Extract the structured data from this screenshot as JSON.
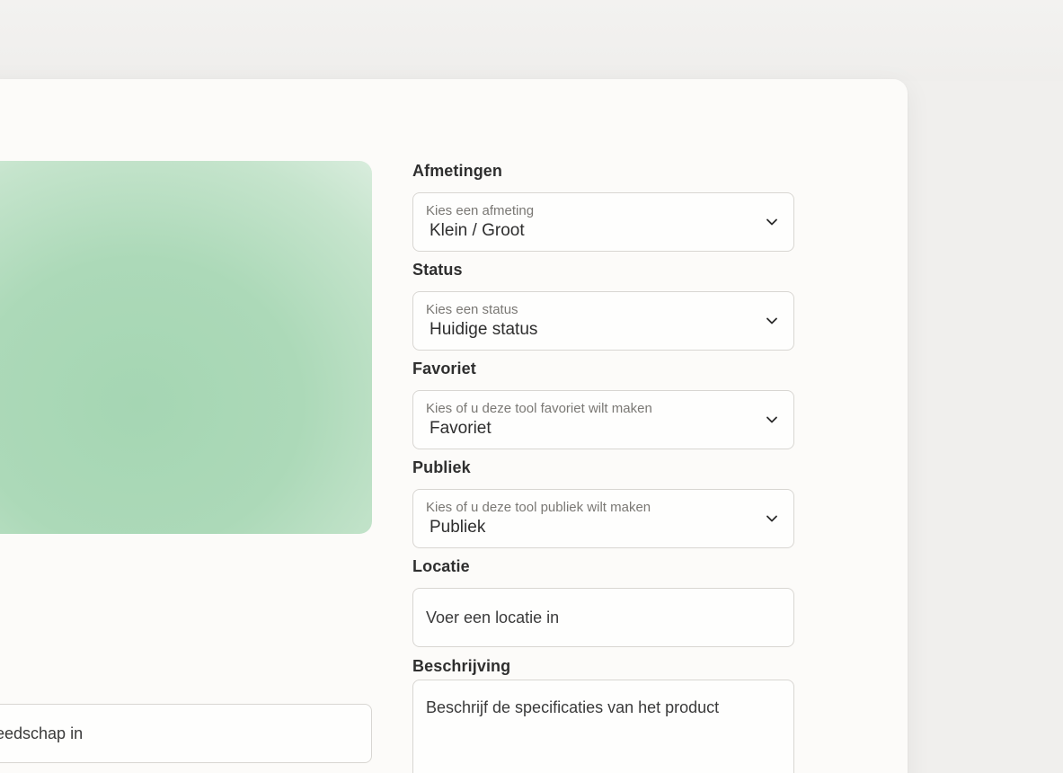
{
  "left_panel": {
    "image_alt": "",
    "name_input_partial": "ereedschap in"
  },
  "form": {
    "afmetingen": {
      "label": "Afmetingen",
      "hint": "Kies een afmeting",
      "value": "Klein / Groot"
    },
    "status": {
      "label": "Status",
      "hint": "Kies een status",
      "value": "Huidige status"
    },
    "favoriet": {
      "label": "Favoriet",
      "hint": "Kies of u deze tool favoriet wilt maken",
      "value": "Favoriet"
    },
    "publiek": {
      "label": "Publiek",
      "hint": "Kies of u deze tool publiek wilt maken",
      "value": "Publiek"
    },
    "locatie": {
      "label": "Locatie",
      "placeholder": "Voer een locatie in"
    },
    "beschrijving": {
      "label": "Beschrijving",
      "placeholder": "Beschrijf de specificaties van het product"
    }
  },
  "colors": {
    "background": "#f0efed",
    "card": "#fcfbf9",
    "image_green": "#a5d6b3",
    "border": "#d8d6d2"
  },
  "icons": {
    "select_chevron": "chevron-down-icon"
  }
}
